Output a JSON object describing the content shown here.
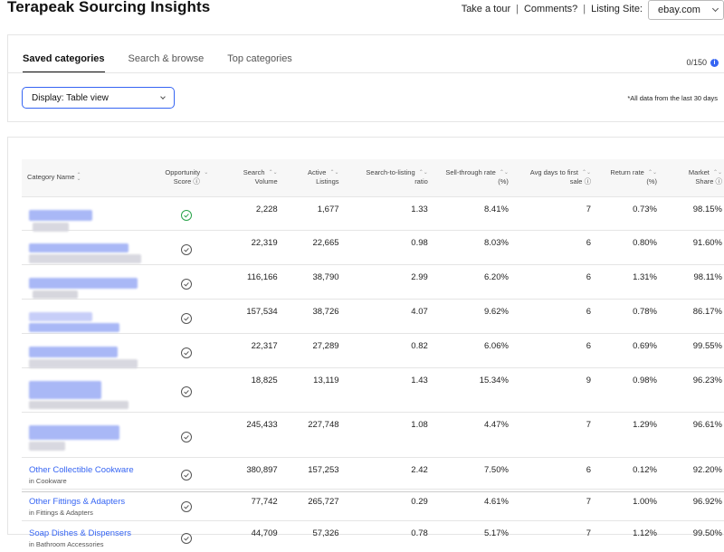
{
  "header": {
    "title": "Terapeak Sourcing Insights",
    "take_tour": "Take a tour",
    "comments": "Comments?",
    "listing_site_label": "Listing Site:",
    "listing_site_value": "ebay.com"
  },
  "tabs": [
    {
      "label": "Saved categories",
      "active": true
    },
    {
      "label": "Search & browse",
      "active": false
    },
    {
      "label": "Top categories",
      "active": false
    }
  ],
  "counter": "0/150",
  "display_select": "Display: Table view",
  "data_note": "*All data from the last 30 days",
  "table": {
    "headers": {
      "category": "Category Name",
      "opportunity_1": "Opportunity",
      "opportunity_2": "Score",
      "search_volume_1": "Search",
      "search_volume_2": "Volume",
      "active_listings_1": "Active",
      "active_listings_2": "Listings",
      "stl_1": "Search-to-listing",
      "stl_2": "ratio",
      "str_1": "Sell-through rate",
      "str_2": "(%)",
      "avg_days_1": "Avg days to first",
      "avg_days_2": "sale",
      "return_1": "Return rate",
      "return_2": "(%)",
      "market_1": "Market",
      "market_2": "Share"
    },
    "rows": [
      {
        "name": "",
        "sub": "",
        "search_volume": "2,228",
        "active_listings": "1,677",
        "ratio": "1.33",
        "sell_through": "8.41%",
        "avg_days": "7",
        "return_rate": "0.73%",
        "market_share": "98.15%"
      },
      {
        "name": "",
        "sub": "",
        "search_volume": "22,319",
        "active_listings": "22,665",
        "ratio": "0.98",
        "sell_through": "8.03%",
        "avg_days": "6",
        "return_rate": "0.80%",
        "market_share": "91.60%"
      },
      {
        "name": "",
        "sub": "",
        "search_volume": "116,166",
        "active_listings": "38,790",
        "ratio": "2.99",
        "sell_through": "6.20%",
        "avg_days": "6",
        "return_rate": "1.31%",
        "market_share": "98.11%"
      },
      {
        "name": "",
        "sub": "",
        "search_volume": "157,534",
        "active_listings": "38,726",
        "ratio": "4.07",
        "sell_through": "9.62%",
        "avg_days": "6",
        "return_rate": "0.78%",
        "market_share": "86.17%"
      },
      {
        "name": "",
        "sub": "",
        "search_volume": "22,317",
        "active_listings": "27,289",
        "ratio": "0.82",
        "sell_through": "6.06%",
        "avg_days": "6",
        "return_rate": "0.69%",
        "market_share": "99.55%"
      },
      {
        "name": "",
        "sub": "",
        "search_volume": "18,825",
        "active_listings": "13,119",
        "ratio": "1.43",
        "sell_through": "15.34%",
        "avg_days": "9",
        "return_rate": "0.98%",
        "market_share": "96.23%"
      },
      {
        "name": "",
        "sub": "",
        "search_volume": "245,433",
        "active_listings": "227,748",
        "ratio": "1.08",
        "sell_through": "4.47%",
        "avg_days": "7",
        "return_rate": "1.29%",
        "market_share": "96.61%"
      },
      {
        "name": "Other Collectible Cookware",
        "sub": "in Cookware",
        "search_volume": "380,897",
        "active_listings": "157,253",
        "ratio": "2.42",
        "sell_through": "7.50%",
        "avg_days": "6",
        "return_rate": "0.12%",
        "market_share": "92.20%"
      },
      {
        "name": "Other Fittings & Adapters",
        "sub": "in Fittings & Adapters",
        "search_volume": "77,742",
        "active_listings": "265,727",
        "ratio": "0.29",
        "sell_through": "4.61%",
        "avg_days": "7",
        "return_rate": "1.00%",
        "market_share": "96.92%"
      },
      {
        "name": "Soap Dishes & Dispensers",
        "sub": "in Bathroom Accessories",
        "search_volume": "44,709",
        "active_listings": "57,326",
        "ratio": "0.78",
        "sell_through": "5.17%",
        "avg_days": "7",
        "return_rate": "1.12%",
        "market_share": "99.50%"
      }
    ]
  }
}
